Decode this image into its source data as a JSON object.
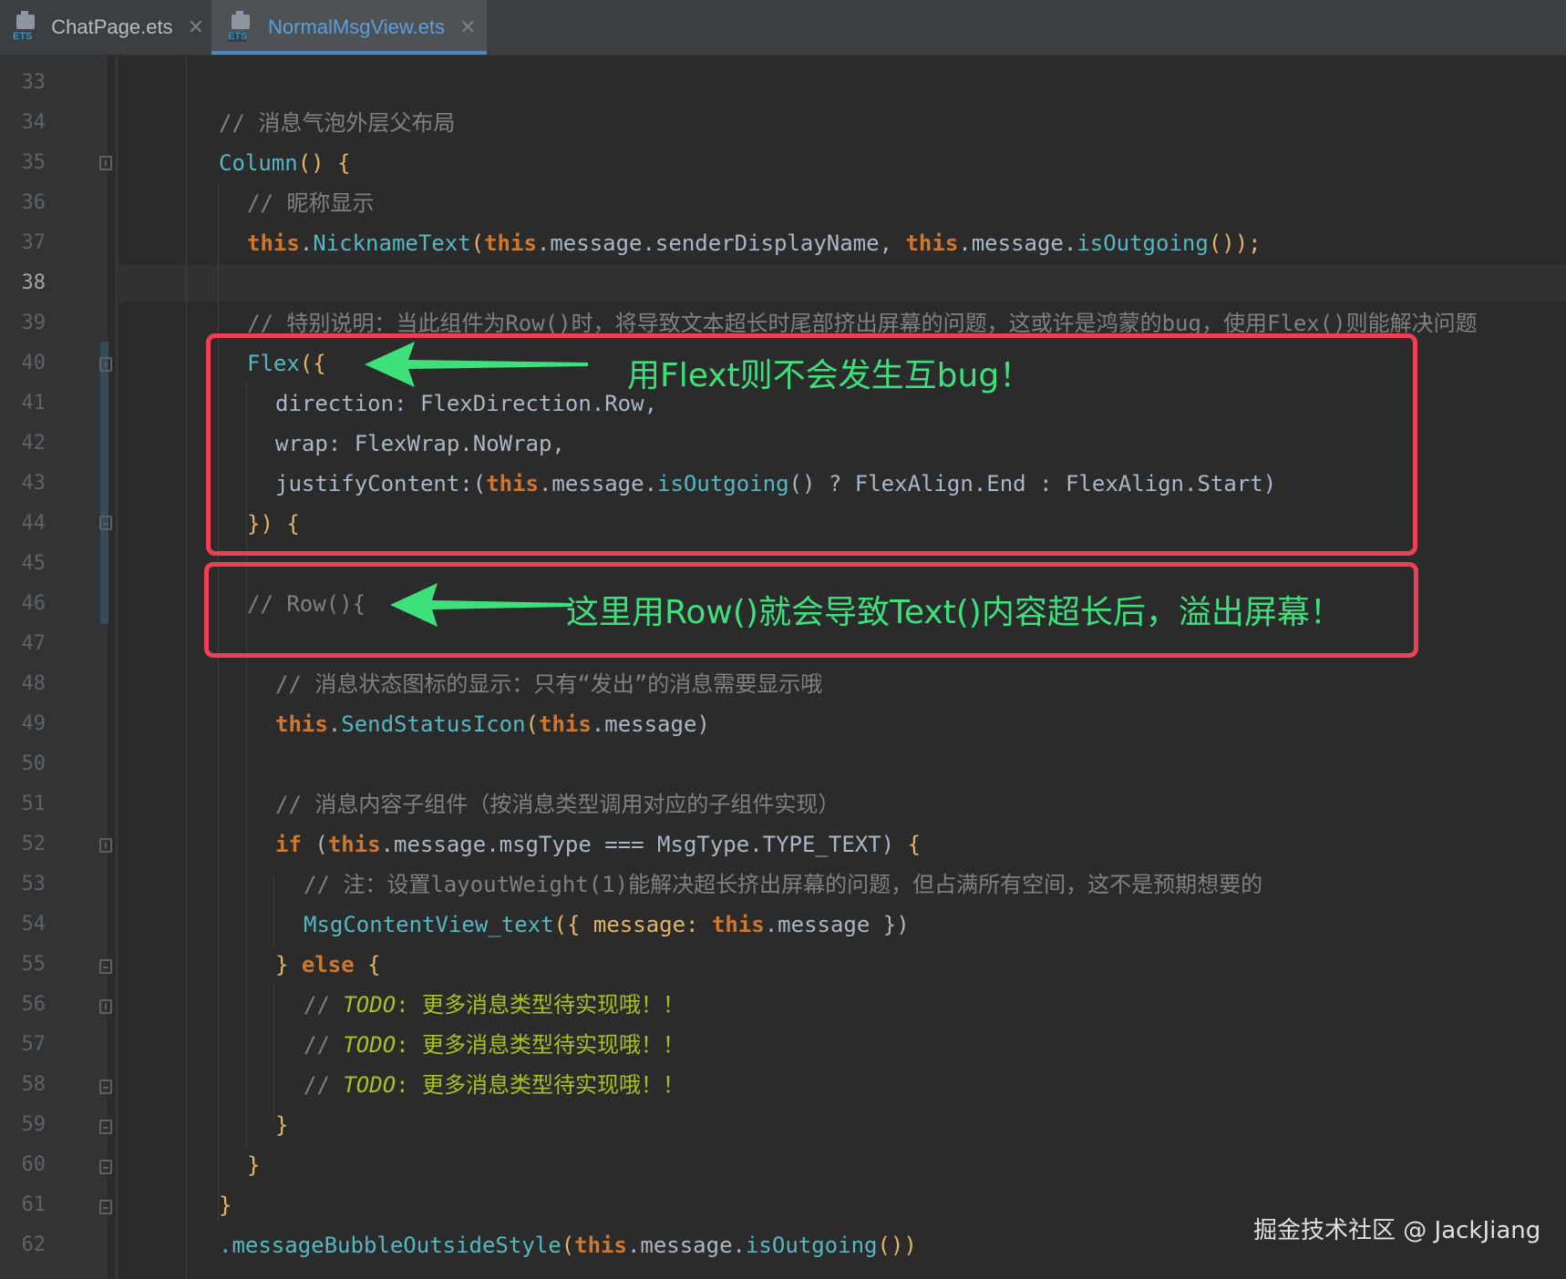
{
  "tabs": [
    {
      "label": "ChatPage.ets",
      "icon": "ets-file-icon",
      "icon_text": "ETS",
      "active": false
    },
    {
      "label": "NormalMsgView.ets",
      "icon": "ets-file-icon",
      "icon_text": "ETS",
      "active": true
    }
  ],
  "editor": {
    "current_line": "38",
    "line_numbers": [
      "33",
      "34",
      "35",
      "36",
      "37",
      "38",
      "39",
      "40",
      "41",
      "42",
      "43",
      "44",
      "45",
      "46",
      "47",
      "48",
      "49",
      "50",
      "51",
      "52",
      "53",
      "54",
      "55",
      "56",
      "57",
      "58",
      "59",
      "60",
      "61",
      "62"
    ],
    "code": {
      "l34_comment": "// 消息气泡外层父布局",
      "l35_fn": "Column",
      "l35_rest": "() ",
      "l35_brace": "{",
      "l36_comment": "// 昵称显示",
      "l37_this1": "this",
      "l37_dot1": ".",
      "l37_fn": "NicknameText",
      "l37_p1": "(",
      "l37_this2": "this",
      "l37_mid": ".message.senderDisplayName, ",
      "l37_this3": "this",
      "l37_mid2": ".message.",
      "l37_fn2": "isOutgoing",
      "l37_end": "());",
      "l39_comment": "// 特别说明：当此组件为Row()时，将导致文本超长时尾部挤出屏幕的问题，这或许是鸿蒙的bug，使用Flex()则能解决问题",
      "l40_fn": "Flex",
      "l40_rest": "({",
      "l41": "direction: FlexDirection.Row,",
      "l42": "wrap: FlexWrap.NoWrap,",
      "l43_a": "justifyContent:(",
      "l43_this": "this",
      "l43_b": ".message.",
      "l43_fn": "isOutgoing",
      "l43_c": "() ? FlexAlign.End : FlexAlign.Start)",
      "l44": "}) ",
      "l44_brace": "{",
      "l46_comment": "// Row(){",
      "l48_comment": "// 消息状态图标的显示：只有“发出”的消息需要显示哦",
      "l49_this": "this",
      "l49_dot": ".",
      "l49_fn": "SendStatusIcon",
      "l49_p": "(",
      "l49_this2": "this",
      "l49_rest": ".message)",
      "l51_comment": "// 消息内容子组件（按消息类型调用对应的子组件实现）",
      "l52_if": "if",
      "l52_a": " (",
      "l52_this": "this",
      "l52_b": ".message.msgType === MsgType.TYPE_TEXT) ",
      "l52_brace": "{",
      "l53_comment": "// 注：设置layoutWeight(1)能解决超长挤出屏幕的问题，但占满所有空间，这不是预期想要的",
      "l54_fn": "MsgContentView_text",
      "l54_a": "({ message: ",
      "l54_this": "this",
      "l54_b": ".message })",
      "l55_a": "} ",
      "l55_else": "else",
      "l55_brace": " {",
      "todo_slash": "// ",
      "todo_kw": "TODO",
      "todo_text": ": 更多消息类型待实现哦！！",
      "l59": "}",
      "l60": "}",
      "l61": "}",
      "l62_fn": ".messageBubbleOutsideStyle",
      "l62_p": "(",
      "l62_this": "this",
      "l62_b": ".message.",
      "l62_fn2": "isOutgoing",
      "l62_c": "())"
    }
  },
  "annotations": {
    "flex_note": "用Flext则不会发生互bug！",
    "row_note": "这里用Row()就会导致Text()内容超长后，溢出屏幕！",
    "highlight_color": "#ee3f55",
    "arrow_color": "#3ee07c"
  },
  "watermark": "掘金技术社区 @ JackJiang"
}
